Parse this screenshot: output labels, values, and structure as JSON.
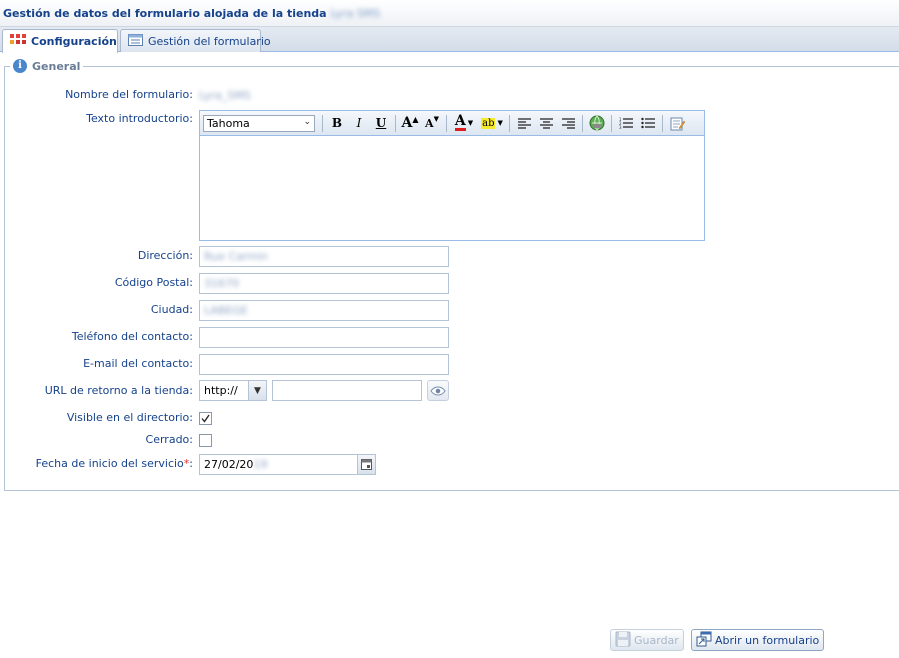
{
  "header": {
    "title": "Gestión de datos del formulario alojada de la tienda",
    "shop_name": "Lyra SMS"
  },
  "tabs": [
    {
      "label": "Configuración",
      "icon": "grid-icon",
      "active": true
    },
    {
      "label": "Gestión del formulario",
      "icon": "form-list-icon",
      "active": false
    }
  ],
  "section": {
    "legend": "General",
    "icon": "info-icon"
  },
  "form": {
    "form_name": {
      "label": "Nombre del formulario:",
      "value": "Lyra_SMS"
    },
    "intro_text": {
      "label": "Texto introductorio:",
      "font": "Tahoma",
      "value": ""
    },
    "address": {
      "label": "Dirección:",
      "value": "Rue Carmin"
    },
    "postal_code": {
      "label": "Código Postal:",
      "value": "31670"
    },
    "city": {
      "label": "Ciudad:",
      "value": "LABEGE"
    },
    "phone": {
      "label": "Teléfono del contacto:",
      "value": ""
    },
    "email": {
      "label": "E-mail del contacto:",
      "value": ""
    },
    "return_url": {
      "label": "URL de retorno a la tienda:",
      "protocol": "http://",
      "value": ""
    },
    "visible": {
      "label": "Visible en el directorio:",
      "checked": true
    },
    "closed": {
      "label": "Cerrado:",
      "checked": false
    },
    "start_date": {
      "label": "Fecha de inicio del servicio",
      "required_mark": "*",
      "colon": ":",
      "value_prefix": "27/02/20",
      "value_suffix": "19"
    }
  },
  "toolbar": {
    "bold": "B",
    "italic": "I",
    "underline": "U",
    "grow": "A",
    "shrink": "A",
    "color": "A",
    "highlight": "ab"
  },
  "buttons": {
    "save": "Guardar",
    "open_form": "Abrir un formulario"
  },
  "colors": {
    "accent": "#15428b",
    "required": "#e03030",
    "border": "#99bbe8"
  }
}
